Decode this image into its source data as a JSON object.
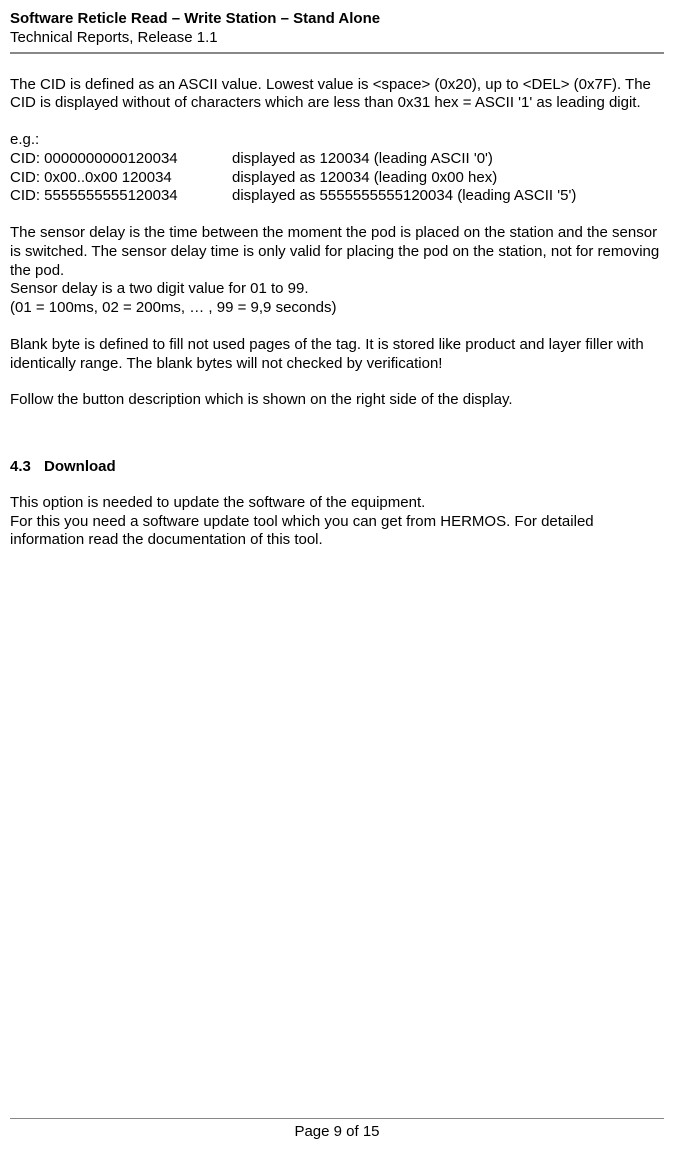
{
  "header": {
    "title": "Software Reticle Read – Write Station – Stand Alone",
    "subtitle": "Technical Reports, Release 1.1"
  },
  "body": {
    "p1": "The CID is defined as an ASCII value. Lowest value is <space> (0x20), up to <DEL> (0x7F). The CID is displayed without of characters which are less than 0x31 hex = ASCII '1' as leading digit.",
    "eg_label": "e.g.:",
    "cid_rows": [
      {
        "left": "CID: 0000000000120034",
        "right": "displayed as 120034 (leading ASCII '0')"
      },
      {
        "left": "CID: 0x00..0x00 120034",
        "right": "displayed as 120034 (leading 0x00 hex)"
      },
      {
        "left": "CID: 5555555555120034",
        "right": "displayed as 5555555555120034 (leading ASCII '5')"
      }
    ],
    "p3_l1": "The sensor delay is the time between the moment the pod is placed on the station and the sensor is switched. The sensor delay time is only valid for placing the pod on the station, not for removing the pod.",
    "p3_l2": "Sensor delay is a two digit value for 01 to 99.",
    "p3_l3": "(01 = 100ms, 02 = 200ms, … , 99 = 9,9 seconds)",
    "p4": "Blank byte is defined to fill not used pages of the tag. It is stored like product and layer filler with identically range. The blank bytes will not checked by verification!",
    "p5": "Follow the button description which is shown on the right side of the display."
  },
  "section": {
    "num": "4.3",
    "title": "Download",
    "p1": "This option is needed to update the software of the equipment.",
    "p2": "For this you need a software update tool which you can get from HERMOS. For detailed information read the documentation of this tool."
  },
  "footer": {
    "page": "Page 9 of 15"
  }
}
